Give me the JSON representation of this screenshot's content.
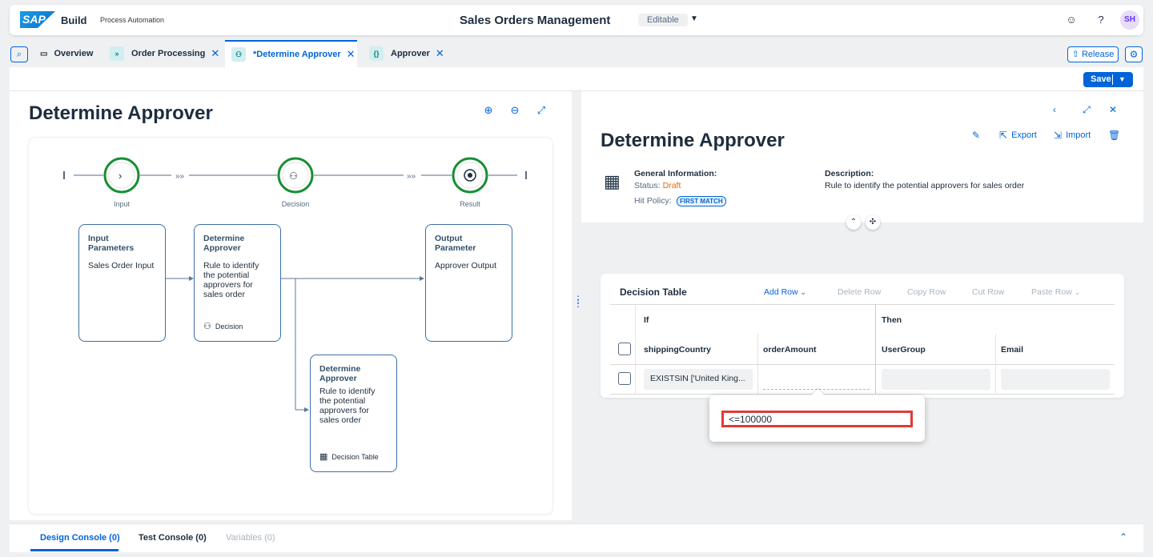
{
  "shell": {
    "logo": "SAP",
    "brand": "Build",
    "brand_sub": "Process Automation",
    "app_title": "Sales Orders Management",
    "mode": "Editable",
    "avatar_initials": "SH"
  },
  "tabs": [
    {
      "label": "Overview",
      "icon": "folder-icon",
      "closable": false
    },
    {
      "label": "Order Processing",
      "icon": "process-icon",
      "closable": true
    },
    {
      "label": "*Determine Approver",
      "icon": "decision-icon",
      "closable": true,
      "active": true
    },
    {
      "label": "Approver",
      "icon": "data-type-icon",
      "closable": true
    }
  ],
  "toolbar": {
    "release_label": "Release",
    "save_label": "Save"
  },
  "left": {
    "title": "Determine Approver",
    "steps": [
      "Input",
      "Decision",
      "Result"
    ],
    "cards": {
      "input": {
        "title": "Input Parameters",
        "desc": "Sales Order Input"
      },
      "decision": {
        "title": "Determine Approver",
        "desc": "Rule to identify the potential approvers for sales order",
        "footer": "Decision"
      },
      "output": {
        "title": "Output Parameter",
        "desc": "Approver Output"
      },
      "table": {
        "title": "Determine Approver",
        "desc": "Rule to identify the potential approvers for sales order",
        "footer": "Decision Table"
      }
    }
  },
  "right": {
    "title": "Determine Approver",
    "export_label": "Export",
    "import_label": "Import",
    "general_info_label": "General Information:",
    "status_label": "Status:",
    "status_value": "Draft",
    "hit_policy_label": "Hit Policy:",
    "hit_policy_value": "FIRST MATCH",
    "description_label": "Description:",
    "description_value": "Rule to identify the potential approvers for sales order",
    "decision_table": {
      "title": "Decision Table",
      "tools": {
        "add_row": "Add Row",
        "delete_row": "Delete Row",
        "copy_row": "Copy Row",
        "cut_row": "Cut Row",
        "paste_row": "Paste Row"
      },
      "if_label": "If",
      "then_label": "Then",
      "columns": [
        "shippingCountry",
        "orderAmount",
        "UserGroup",
        "Email"
      ],
      "rows": [
        {
          "shippingCountry": "EXISTSIN ['United King...",
          "orderAmount": "",
          "UserGroup": "",
          "Email": ""
        }
      ]
    },
    "popover_value": "<=100000"
  },
  "console": {
    "tabs": [
      "Design Console (0)",
      "Test Console (0)",
      "Variables (0)"
    ]
  }
}
